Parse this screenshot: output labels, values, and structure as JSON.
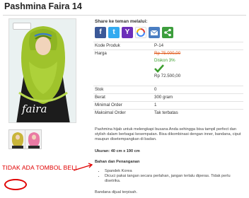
{
  "product": {
    "title": "Pashmina Faira 14",
    "photo_brand": "faira"
  },
  "share": {
    "label": "Share ke teman melalui:",
    "icons": [
      "facebook-icon",
      "twitter-icon",
      "yahoo-icon",
      "google-icon",
      "email-icon",
      "share-icon"
    ]
  },
  "details": {
    "kode_label": "Kode Produk",
    "kode_value": "P-14",
    "harga_label": "Harga",
    "harga_old": "Rp 75.000,00",
    "diskon": "Diskon 3%",
    "harga_new": "Rp 72.500,00",
    "stok_label": "Stok",
    "stok_value": "0",
    "berat_label": "Berat",
    "berat_value": "300 gram",
    "min_label": "Minimal Order",
    "min_value": "1",
    "max_label": "Maksimal Order",
    "max_value": "Tak terbatas"
  },
  "description": {
    "para": "Pashmina hijab untuk melengkapi busana Anda sehingga bisa tampil perfect dan stylish dalam berbagai kesempatan. Bisa dikombinasi dengan inner, bandana, ciput maupun disetempangkan di badan.",
    "size": "Ukuran: 40 cm x 190 cm",
    "bahan_heading": "Bahan dan Penanganan",
    "bullets": [
      "Spandek Korea",
      "Dicuci pakai tangan secara perlahan, jangan terlalu diperas. Tidak perlu disetrika."
    ],
    "end": "Bandana dijual terpisah."
  },
  "annotation": {
    "text": "TIDAK ADA TOMBOL BELI",
    "color": "#e00000"
  },
  "colors": {
    "price_old": "#e05b1f",
    "discount": "#3c9e2e",
    "check": "#3c9e2e"
  }
}
